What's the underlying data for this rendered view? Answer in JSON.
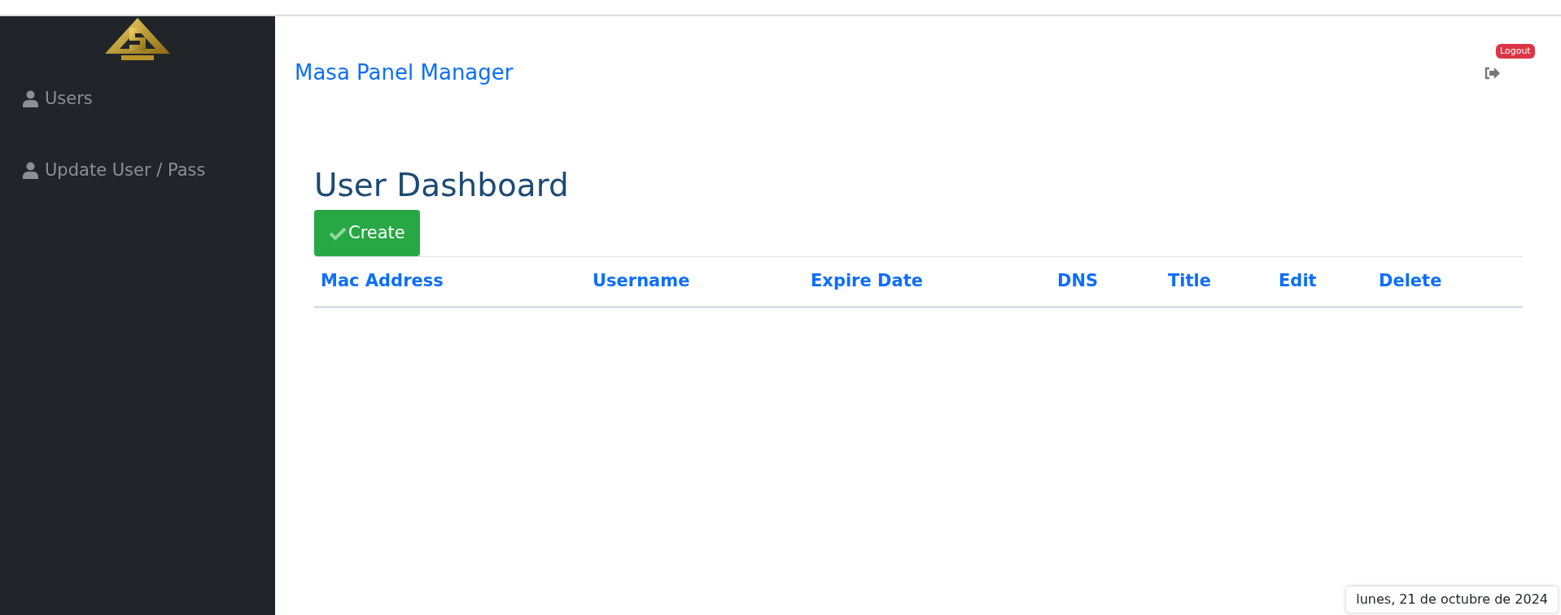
{
  "sidebar": {
    "items": [
      {
        "label": "Users"
      },
      {
        "label": "Update User / Pass"
      }
    ]
  },
  "header": {
    "title": "Masa Panel Manager",
    "logout_badge": "Logout"
  },
  "page": {
    "title": "User Dashboard",
    "create_button": "Create"
  },
  "table": {
    "columns": [
      "Mac Address",
      "Username",
      "Expire Date",
      "DNS",
      "Title",
      "Edit",
      "Delete"
    ]
  },
  "date_popup": "lunes, 21 de octubre de 2024"
}
